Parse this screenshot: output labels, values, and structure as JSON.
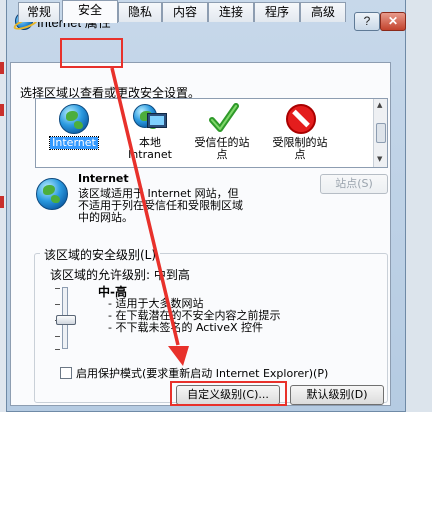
{
  "window": {
    "title": "Internet 属性",
    "help_label": "?",
    "close_label": "✕"
  },
  "tabs": [
    "常规",
    "安全",
    "隐私",
    "内容",
    "连接",
    "程序",
    "高级"
  ],
  "active_tab": "安全",
  "security": {
    "prompt": "选择区域以查看或更改安全设置。",
    "zones": [
      {
        "label": "Internet",
        "icon": "globe-icon",
        "selected": true
      },
      {
        "label": "本地\nIntranet",
        "icon": "intranet-icon",
        "selected": false
      },
      {
        "label": "受信任的站\n点",
        "icon": "check-icon",
        "selected": false
      },
      {
        "label": "受限制的站\n点",
        "icon": "restricted-icon",
        "selected": false
      }
    ],
    "zone_info": {
      "title": "Internet",
      "description": "该区域适用于 Internet 网站，但\n不适用于列在受信任和受限制区域\n中的网站。"
    },
    "sites_button": "站点(S)",
    "level_group_label": "该区域的安全级别(L)",
    "allowed_levels": "该区域的允许级别: 中到高",
    "level": {
      "name": "中-高",
      "bullets": [
        "- 适用于大多数网站",
        "- 在下载潜在的不安全内容之前提示",
        "- 不下载未签名的 ActiveX 控件"
      ]
    },
    "protected_mode_label": "启用保护模式(要求重新启动 Internet Explorer)(P)",
    "protected_mode_checked": false,
    "custom_level_button": "自定义级别(C)...",
    "default_level_button": "默认级别(D)"
  },
  "annotation_color": "#e8312b"
}
